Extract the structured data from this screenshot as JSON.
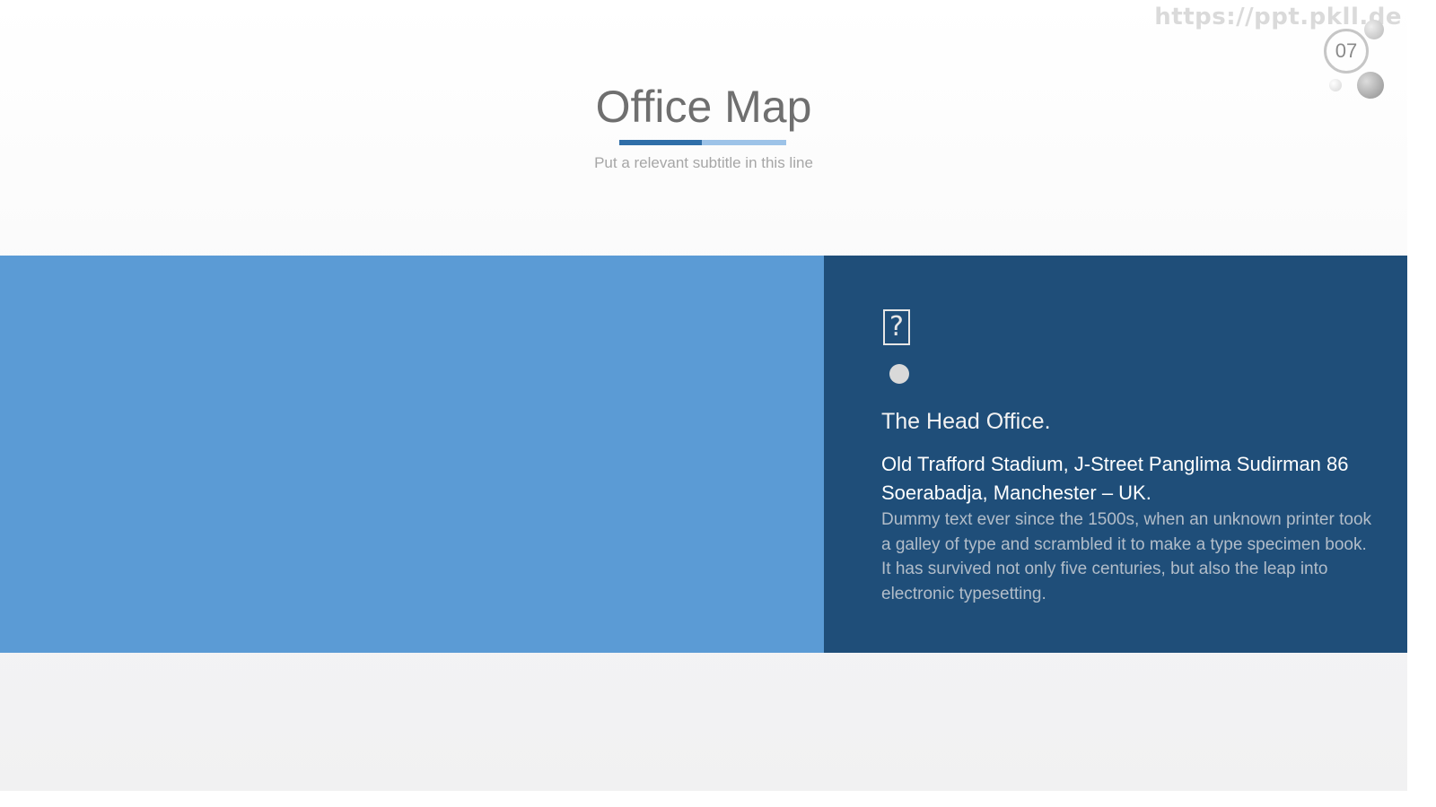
{
  "watermark": "https://ppt.pkll.de",
  "page_number": "07",
  "slide": {
    "title": "Office Map",
    "subtitle": "Put a relevant subtitle in this line"
  },
  "colors": {
    "accent_dark": "#2f6ea8",
    "accent_light": "#9dc3e8",
    "map_panel": "#5b9bd5",
    "info_panel": "#1f4e79"
  },
  "info": {
    "icon": "missing-image-icon",
    "heading": "The Head Office.",
    "address": "Old Trafford Stadium, J-Street Panglima Sudirman 86 Soerabadja, Manchester – UK.",
    "description": "Dummy text ever since the 1500s, when an unknown printer took a galley of type and scrambled it to make a type specimen book. It has survived not only five centuries, but also the leap into electronic typesetting."
  }
}
